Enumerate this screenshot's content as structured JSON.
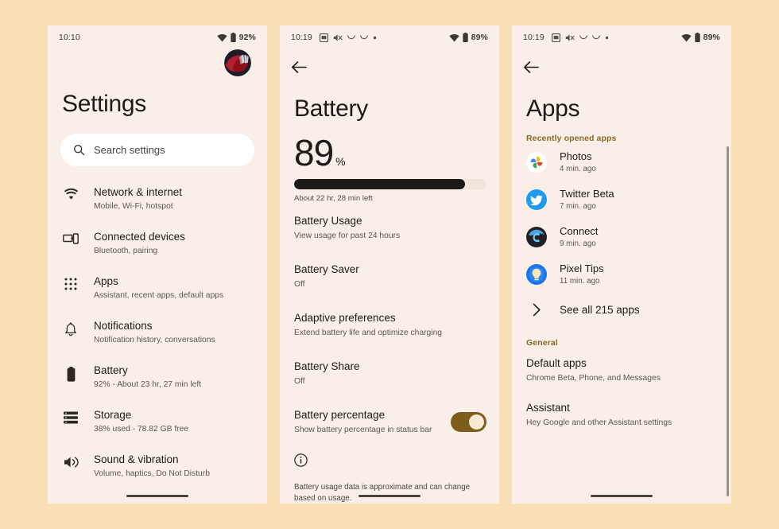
{
  "theme": {
    "page_background": "#f8dfb6",
    "phone_background": "#f9efe8",
    "accent": "#7d5c1c",
    "section_label": "#8a6a22",
    "text_primary": "#1d1b19",
    "text_secondary": "#5c554e",
    "toggle_on": "#7d5c1c",
    "bar_fill": "#1b1a18",
    "bar_track": "#efe5dc"
  },
  "settings_phone": {
    "status_bar": {
      "time": "10:10",
      "battery_percent": "92%",
      "left_icons": [],
      "right_icons": [
        "wifi-icon",
        "battery-icon"
      ]
    },
    "avatar_name": "account-avatar",
    "title": "Settings",
    "search": {
      "placeholder": "Search settings",
      "value": "",
      "icon": "search-icon"
    },
    "items": [
      {
        "icon": "wifi-icon",
        "title": "Network & internet",
        "subtitle": "Mobile, Wi-Fi, hotspot"
      },
      {
        "icon": "devices-icon",
        "title": "Connected devices",
        "subtitle": "Bluetooth, pairing"
      },
      {
        "icon": "apps-grid-icon",
        "title": "Apps",
        "subtitle": "Assistant, recent apps, default apps"
      },
      {
        "icon": "bell-icon",
        "title": "Notifications",
        "subtitle": "Notification history, conversations"
      },
      {
        "icon": "battery-icon",
        "title": "Battery",
        "subtitle": "92% - About 23 hr, 27 min left"
      },
      {
        "icon": "storage-icon",
        "title": "Storage",
        "subtitle": "38% used - 78.82 GB free"
      },
      {
        "icon": "volume-icon",
        "title": "Sound & vibration",
        "subtitle": "Volume, haptics, Do Not Disturb"
      }
    ]
  },
  "battery_phone": {
    "status_bar": {
      "time": "10:19",
      "battery_percent": "89%",
      "left_icons": [
        "screenshot-icon",
        "mute-icon",
        "crescent-icon",
        "crescent-icon",
        "dot-icon"
      ],
      "right_icons": [
        "wifi-icon",
        "battery-icon"
      ]
    },
    "back_icon": "back-arrow-icon",
    "title": "Battery",
    "level": {
      "number": "89",
      "symbol": "%",
      "fill_percent": 89,
      "caption": "About 22 hr, 28 min left"
    },
    "items": [
      {
        "title": "Battery Usage",
        "subtitle": "View usage for past 24 hours",
        "toggle": null
      },
      {
        "title": "Battery Saver",
        "subtitle": "Off",
        "toggle": null
      },
      {
        "title": "Adaptive preferences",
        "subtitle": "Extend battery life and optimize charging",
        "toggle": null
      },
      {
        "title": "Battery Share",
        "subtitle": "Off",
        "toggle": null
      },
      {
        "title": "Battery percentage",
        "subtitle": "Show battery percentage in status bar",
        "toggle": "on"
      }
    ],
    "info_icon": "info-icon",
    "footnote": "Battery usage data is approximate and can change based on usage."
  },
  "apps_phone": {
    "status_bar": {
      "time": "10:19",
      "battery_percent": "89%",
      "left_icons": [
        "screenshot-icon",
        "mute-icon",
        "crescent-icon",
        "crescent-icon",
        "dot-icon"
      ],
      "right_icons": [
        "wifi-icon",
        "battery-icon"
      ]
    },
    "back_icon": "back-arrow-icon",
    "title": "Apps",
    "recent_section_label": "Recently opened apps",
    "recent_apps": [
      {
        "icon": "google-photos-icon",
        "name": "Photos",
        "time": "4 min. ago"
      },
      {
        "icon": "twitter-icon",
        "name": "Twitter Beta",
        "time": "7 min. ago"
      },
      {
        "icon": "connect-icon",
        "name": "Connect",
        "time": "9 min. ago"
      },
      {
        "icon": "pixel-tips-icon",
        "name": "Pixel Tips",
        "time": "11 min. ago"
      }
    ],
    "see_all": {
      "icon": "chevron-right-icon",
      "label": "See all 215 apps"
    },
    "general_section_label": "General",
    "general_items": [
      {
        "title": "Default apps",
        "subtitle": "Chrome Beta, Phone, and Messages"
      },
      {
        "title": "Assistant",
        "subtitle": "Hey Google and other Assistant settings"
      }
    ]
  }
}
